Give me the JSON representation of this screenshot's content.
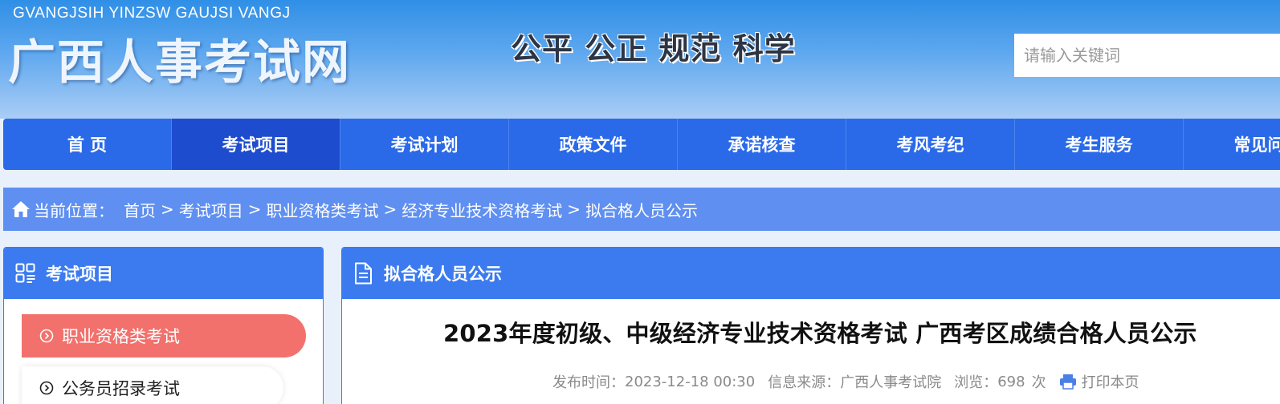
{
  "header": {
    "logo_pinyin": "GVANGJSIH YINZSW GAUJSI VANGJ",
    "logo_cn": "广西人事考试网",
    "slogan": "公平  公正  规范  科学",
    "search_placeholder": "请输入关键词"
  },
  "nav": {
    "items": [
      "首 页",
      "考试项目",
      "考试计划",
      "政策文件",
      "承诺核查",
      "考风考纪",
      "考生服务",
      "常见问题"
    ],
    "active_index": 1
  },
  "breadcrumb": {
    "label": "当前位置：",
    "items": [
      "首页",
      "考试项目",
      "职业资格类考试",
      "经济专业技术资格考试",
      "拟合格人员公示"
    ],
    "separator": ">"
  },
  "sidebar": {
    "title": "考试项目",
    "items": [
      "职业资格类考试",
      "公务员招录考试"
    ],
    "active_index": 0
  },
  "content": {
    "section_title": "拟合格人员公示",
    "article_title": "2023年度初级、中级经济专业技术资格考试 广西考区成绩合格人员公示",
    "meta": {
      "publish_label": "发布时间：",
      "publish_time": "2023-12-18 00:30",
      "source_label": "信息来源：",
      "source": "广西人事考试院",
      "views_label": "浏览：",
      "views": "698",
      "views_unit": "次",
      "print_label": "打印本页"
    }
  },
  "colors": {
    "nav_bg": "#2a6ae8",
    "nav_active": "#1e4ccf",
    "breadcrumb_bg": "#5f8ff0",
    "panel_head": "#3c7bef",
    "sidebar_active": "#f2716d"
  }
}
